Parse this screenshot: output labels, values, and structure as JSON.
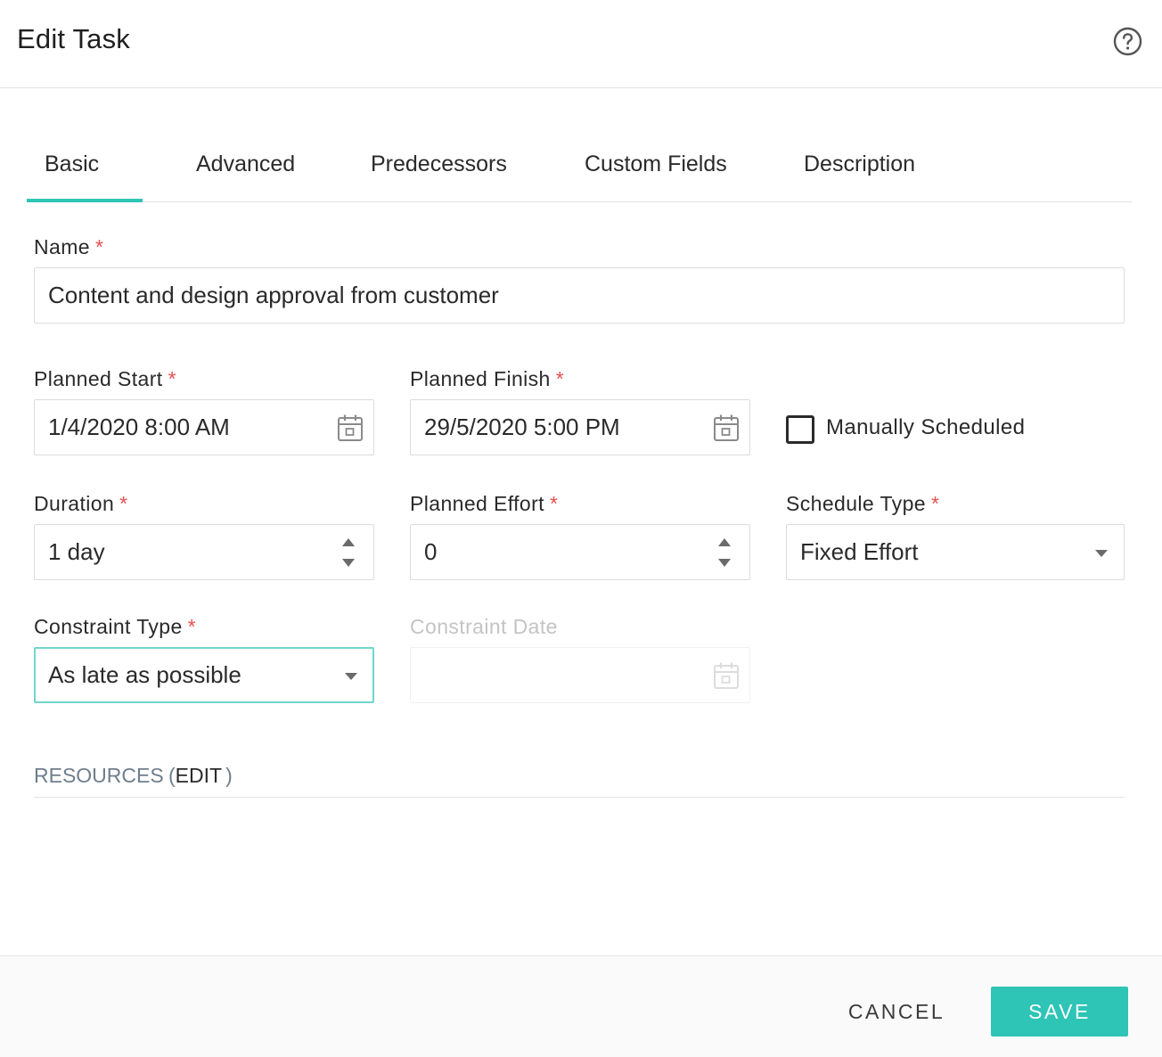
{
  "dialog": {
    "title": "Edit Task"
  },
  "tabs": [
    {
      "label": "Basic",
      "active": true
    },
    {
      "label": "Advanced",
      "active": false
    },
    {
      "label": "Predecessors",
      "active": false
    },
    {
      "label": "Custom Fields",
      "active": false
    },
    {
      "label": "Description",
      "active": false
    }
  ],
  "colors": {
    "accent": "#2ec4b6",
    "required": "#e8504f",
    "muted": "#6f7e8c"
  },
  "form": {
    "required_mark": "*",
    "name": {
      "label": "Name",
      "value": "Content and design approval from customer"
    },
    "planned_start": {
      "label": "Planned Start",
      "value": "1/4/2020 8:00 AM",
      "icon": "calendar-icon"
    },
    "planned_finish": {
      "label": "Planned Finish",
      "value": "29/5/2020 5:00 PM",
      "icon": "calendar-icon"
    },
    "manually_scheduled": {
      "label": "Manually Scheduled",
      "checked": false
    },
    "duration": {
      "label": "Duration",
      "value": "1 day"
    },
    "planned_effort": {
      "label": "Planned Effort",
      "value": "0"
    },
    "schedule_type": {
      "label": "Schedule Type",
      "value": "Fixed Effort"
    },
    "constraint_type": {
      "label": "Constraint Type",
      "value": "As late as possible"
    },
    "constraint_date": {
      "label": "Constraint Date",
      "value": "",
      "disabled": true
    }
  },
  "resources": {
    "title": "RESOURCES",
    "edit_label": "EDIT",
    "open_paren": "(",
    "close_paren": ")"
  },
  "footer": {
    "cancel_label": "CANCEL",
    "save_label": "SAVE"
  }
}
